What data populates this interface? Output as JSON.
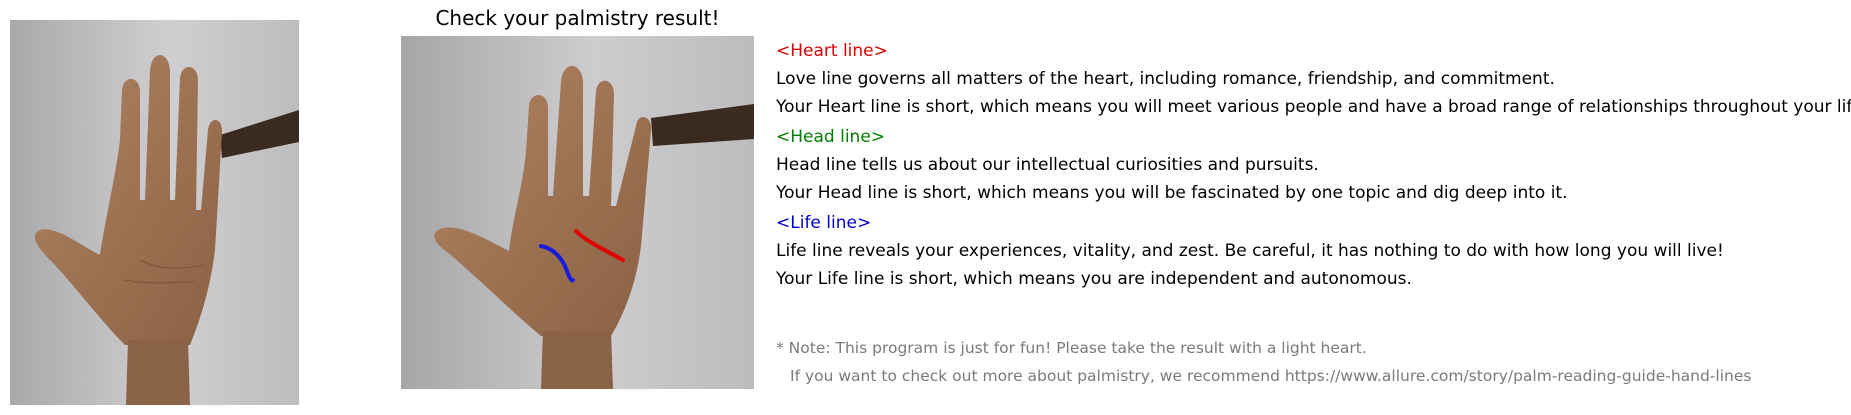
{
  "title": "Check your palmistry result!",
  "lines": [
    {
      "heading": "<Heart line>",
      "color": "#e00000",
      "description": "Love line governs all matters of the heart, including romance, friendship, and commitment.",
      "result": "Your Heart line is short, which means you will meet various people and have a broad range of relationships throughout your life."
    },
    {
      "heading": "<Head line>",
      "color": "#008000",
      "description": "Head line tells us about our intellectual curiosities and pursuits.",
      "result": "Your Head line is short, which means you will be fascinated by one topic and dig deep into it."
    },
    {
      "heading": "<Life line>",
      "color": "#0000cc",
      "description": "Life line reveals your experiences, vitality, and zest. Be careful, it has nothing to do with how long you will live!",
      "result": "Your Life line is short, which means you are independent and autonomous."
    }
  ],
  "note": {
    "line1": "* Note: This program is just for fun! Please take the result with a light heart.",
    "line2": "If you want to check out more about palmistry, we recommend https://www.allure.com/story/palm-reading-guide-hand-lines",
    "color": "#7a7a7a"
  },
  "images": {
    "original": "palm-photo",
    "result": "palm-photo-with-lines"
  }
}
